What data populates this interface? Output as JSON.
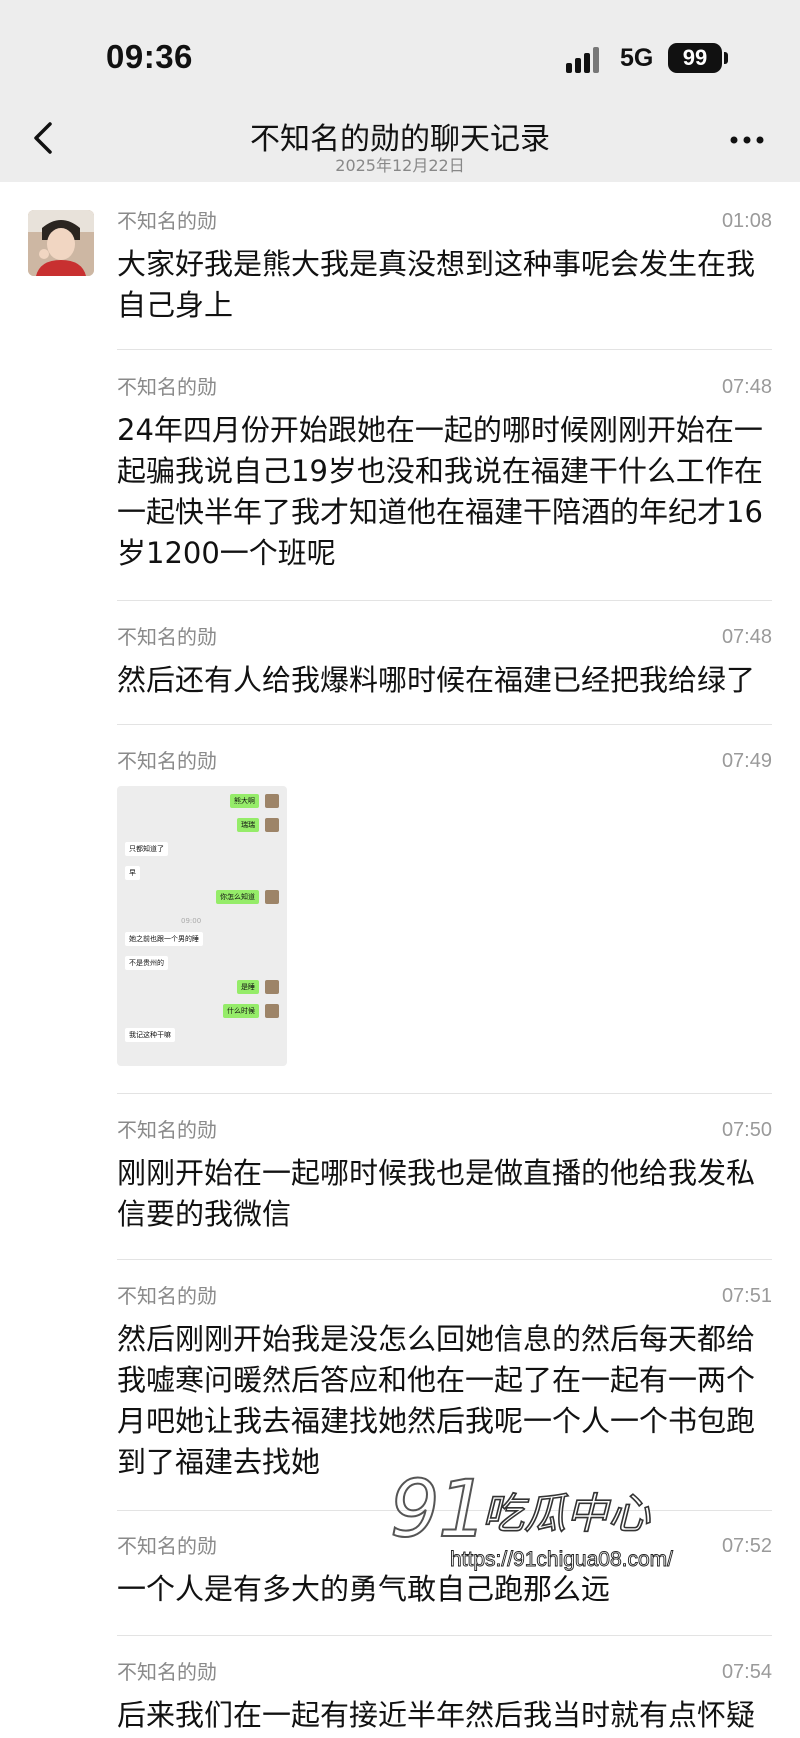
{
  "status_bar": {
    "time": "09:36",
    "network": "5G",
    "battery": "99"
  },
  "header": {
    "title": "不知名的勋的聊天记录",
    "date": "2025年12月22日"
  },
  "messages": [
    {
      "sender": "不知名的勋",
      "time": "01:08",
      "text": "大家好我是熊大我是真没想到这种事呢会发生在我自己身上"
    },
    {
      "sender": "不知名的勋",
      "time": "07:48",
      "text": "24年四月份开始跟她在一起的哪时候刚刚开始在一起骗我说自己19岁也没和我说在福建干什么工作在一起快半年了我才知道他在福建干陪酒的年纪才16岁1200一个班呢"
    },
    {
      "sender": "不知名的勋",
      "time": "07:48",
      "text": "然后还有人给我爆料哪时候在福建已经把我给绿了"
    },
    {
      "sender": "不知名的勋",
      "time": "07:49",
      "image": true
    },
    {
      "sender": "不知名的勋",
      "time": "07:50",
      "text": "刚刚开始在一起哪时候我也是做直播的他给我发私信要的我微信"
    },
    {
      "sender": "不知名的勋",
      "time": "07:51",
      "text": "然后刚刚开始我是没怎么回她信息的然后每天都给我嘘寒问暖然后答应和他在一起了在一起有一两个月吧她让我去福建找她然后我呢一个人一个书包跑到了福建去找她"
    },
    {
      "sender": "不知名的勋",
      "time": "07:52",
      "text": "一个人是有多大的勇气敢自己跑那么远"
    },
    {
      "sender": "不知名的勋",
      "time": "07:54",
      "text": "后来我们在一起有接近半年然后我当时就有点怀疑"
    }
  ],
  "screenshot_chat": [
    {
      "side": "right",
      "text": "熊大啊"
    },
    {
      "side": "right",
      "text": "瑞瑞"
    },
    {
      "side": "left",
      "text": "只都知道了"
    },
    {
      "side": "left",
      "text": "早"
    },
    {
      "side": "right",
      "text": "你怎么知道"
    },
    {
      "side": "center",
      "text": "09:00"
    },
    {
      "side": "left",
      "text": "她之前也跟一个男的睡"
    },
    {
      "side": "left",
      "text": "不是贵州的"
    },
    {
      "side": "right",
      "text": "是睡"
    },
    {
      "side": "right",
      "text": "什么时候"
    },
    {
      "side": "left",
      "text": "我记这种干嘛"
    }
  ],
  "watermark": {
    "brand": "吃瓜中心",
    "url": "https://91chigua08.com/"
  },
  "colors": {
    "topbar": "#ededed",
    "bubble_green": "#95ec69",
    "meta_gray": "#8a8a8a"
  }
}
